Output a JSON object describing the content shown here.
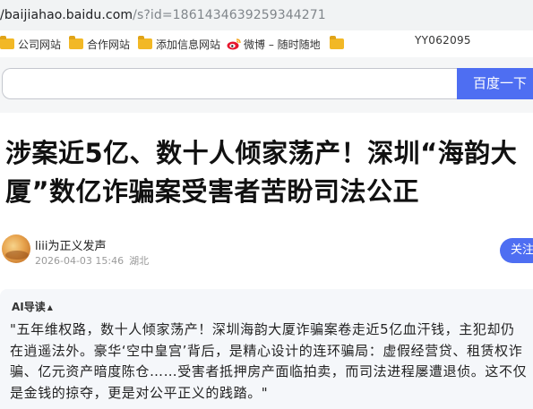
{
  "browser": {
    "url_host": "/baijiahao.baidu.com",
    "url_path": "/s?id=1861434639259344271"
  },
  "bookmarks": [
    {
      "label": "公司网站",
      "icon": "folder-icon"
    },
    {
      "label": "合作网站",
      "icon": "folder-icon"
    },
    {
      "label": "添加信息网站",
      "icon": "folder-icon"
    },
    {
      "label": "微博 – 随时随地",
      "icon": "weibo-icon"
    },
    {
      "label": "",
      "icon": "folder-icon"
    }
  ],
  "user_id": "YY062095",
  "search": {
    "placeholder": "",
    "button_label": "百度一下"
  },
  "article": {
    "title": "涉案近5亿、数十人倾家荡产！深圳“海韵大厦”数亿诈骗案受害者苦盼司法公正",
    "author": "liii为正义发声",
    "date": "2026-04-03 15:46",
    "location": "湖北",
    "follow_label": "关注"
  },
  "ai_summary": {
    "label": "AI导读",
    "caret": "▲",
    "text": "\"五年维权路，数十人倾家荡产！深圳海韵大厦诈骗案卷走近5亿血汗钱，主犯却仍在逍遥法外。豪华‘空中皇宫’背后，是精心设计的连环骗局：虚假经营贷、租赁权诈骗、亿元资产暗度陈仓……受害者抵押房产面临拍卖，而司法进程屡遭退侦。这不仅是金钱的掠夺，更是对公平正义的践踏。\""
  },
  "colors": {
    "accent": "#4e6ef2",
    "folder": "#f2b826",
    "ai_background": "#f5f7fa"
  }
}
